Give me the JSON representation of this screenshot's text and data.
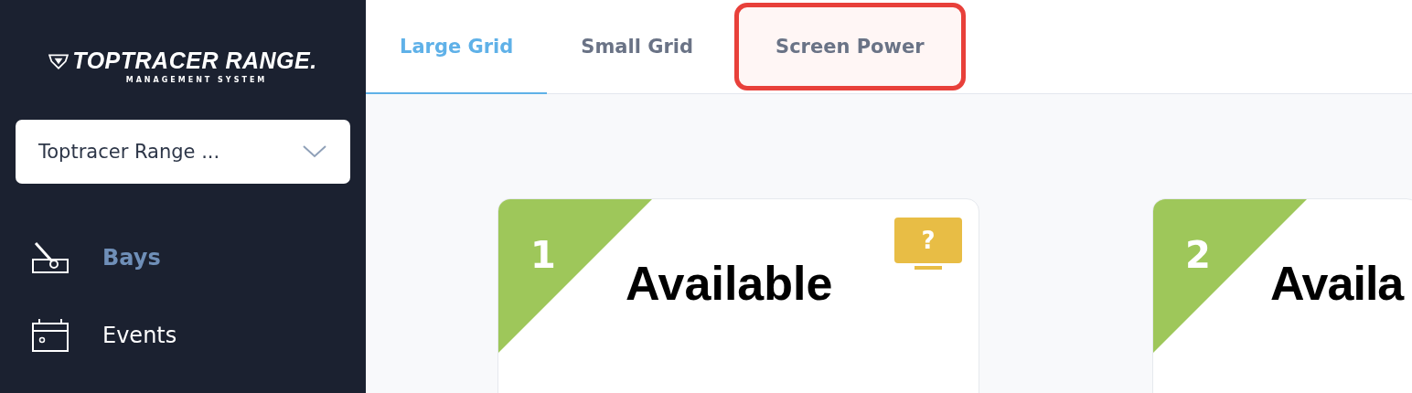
{
  "sidebar": {
    "logo": {
      "title": "TOPTRACER RANGE.",
      "subtitle": "MANAGEMENT SYSTEM"
    },
    "venue_select": {
      "value": "Toptracer Range ..."
    },
    "items": [
      {
        "label": "Bays",
        "kind": "bays",
        "selected": true
      },
      {
        "label": "Events",
        "kind": "events",
        "selected": false
      }
    ]
  },
  "tabs": [
    {
      "label": "Large Grid",
      "selected": true,
      "highlighted": false
    },
    {
      "label": "Small Grid",
      "selected": false,
      "highlighted": false
    },
    {
      "label": "Screen Power",
      "selected": false,
      "highlighted": true
    }
  ],
  "bays": [
    {
      "number": "1",
      "status": "Available",
      "color": "#9ec75a",
      "screen": {
        "label": "?",
        "color": "#e8bd45"
      }
    },
    {
      "number": "2",
      "status": "Availa",
      "color": "#9ec75a"
    }
  ]
}
